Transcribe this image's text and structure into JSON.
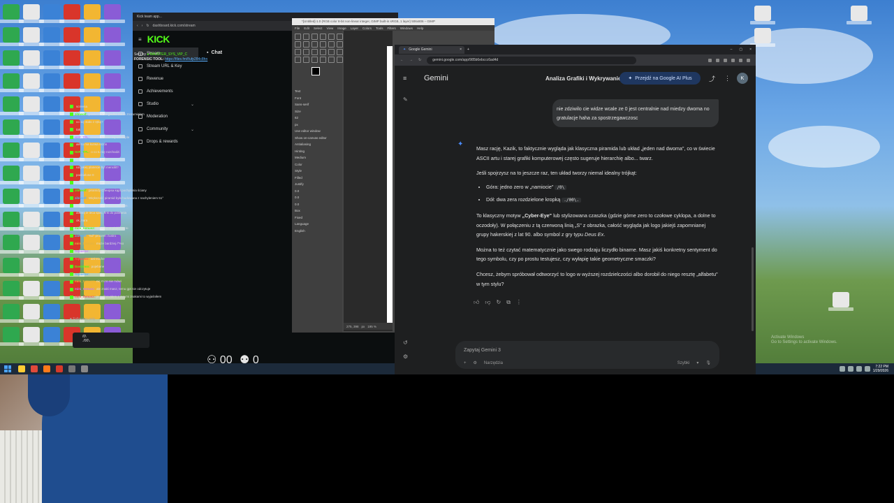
{
  "kick": {
    "tab_title": "Kick team app...",
    "url": "dashboard.kick.com/stream",
    "logo": "KICK",
    "sidebar": [
      {
        "label": "Stream",
        "active": true
      },
      {
        "label": "Stream URL & Key"
      },
      {
        "label": "Revenue"
      },
      {
        "label": "Achievements"
      },
      {
        "label": "Studio",
        "chevron": true
      },
      {
        "label": "Moderation"
      },
      {
        "label": "Community",
        "chevron": true
      },
      {
        "label": "Drops & rewards"
      }
    ],
    "chat_title": "Chat",
    "pinned_by": "Sent by",
    "pinned_user": "MAJSTER_SYS_VIP_C",
    "pinned_text": "FORENSIC TOOL:",
    "pinned_link": "https://files.fm/f/ufp284c8hn",
    "messages": [
      {
        "user": "",
        "text": "screena"
      },
      {
        "user": "zibiwolf:",
        "text": "powierzchnia gladka tak to zrozumiałam"
      },
      {
        "user": "",
        "text": "co się stało z ręką?"
      },
      {
        "user": "",
        "text": "tak"
      },
      {
        "user": "H2P_TPL:",
        "text": "czemu bawisz się w Dimple"
      },
      {
        "user": "",
        "text": "ale to ma kurwa rezon"
      },
      {
        "user": "H2P_TPL:",
        "text": "o co tu się rozchodzi"
      },
      {
        "user": "",
        "text": "na jakiej planecie jest?"
      },
      {
        "user": "",
        "text": "na jakiej planecie byt mencilit?"
      },
      {
        "user": "",
        "text": "podzielone 0"
      },
      {
        "user": "",
        "text": "odbiciem lustra lustrem?"
      },
      {
        "user": "zibiwolf:",
        "text": "piramidy Cheopsa kąpt pochylenia ściany"
      },
      {
        "user": "zibiwolf:",
        "text": "Większość piramid była budowana z nachyleniem 51°"
      },
      {
        "user": "",
        "text": "pokazany kąt padania światła, zatem"
      },
      {
        "user": "",
        "text": "dotarą ie ieca spac, link do pobrania"
      },
      {
        "user": "",
        "text": "ok, nara"
      },
      {
        "user": "mini_tomusz:",
        "text": "słyszysz te piski? co to"
      },
      {
        "user": "zibiwolf:",
        "text": "%d° procent i lustro"
      },
      {
        "user": "mini_tomusz:",
        "text": "może bardziej /^%o"
      },
      {
        "user": "Aquaster:",
        "text": "co teraz robisz?"
      },
      {
        "user": "Aquaster:",
        "text": "ani troche"
      },
      {
        "user": "Davichoo:",
        "text": "pojebane"
      },
      {
        "user": "Aquaster:",
        "text": ""
      },
      {
        "user": "mini_tomusz:",
        "text": "nic mi to nie mówi"
      },
      {
        "user": "mini_tomusz:",
        "text": "ale znaki masz, temu gpt nie odczytuje"
      },
      {
        "user": "mini_tomusz:",
        "text": "ja próbowałem z innymi znakami to wyjaśniłem"
      }
    ],
    "followers_only": "Followers only",
    "input_text_1": "/0\\",
    "input_text_2": "./00\\.",
    "viewers": "00",
    "count": "0"
  },
  "gimp": {
    "title": "*[Untitled]-1.0 (RGB color 8-bit non-linear integer, GIMP built-in sRGB, 1 layer) 506x806 – GIMP",
    "menu": [
      "File",
      "Edit",
      "Select",
      "View",
      "Image",
      "Layer",
      "Colors",
      "Tools",
      "Filters",
      "Windows",
      "Help"
    ],
    "options": [
      "Text",
      "Font",
      "Sans-serif",
      "Size",
      "62",
      "px",
      "Use editor window",
      "Show on-canvas editor",
      "Antialiasing",
      "Hinting",
      "Medium",
      "Color",
      "Style",
      "Filled",
      "Justify",
      "0.0",
      "0.0",
      "0.0",
      "Box",
      "Fixed",
      "Language",
      "English"
    ],
    "zoom": "195 %",
    "coords": "275, 398",
    "unit": "px"
  },
  "chrome": {
    "tab_title": "Google Gemini",
    "url": "gemini.google.com/app/985b6ebccc6ad4d"
  },
  "gemini": {
    "brand": "Gemini",
    "chat_title": "Analiza Grafiki i Wykrywanie",
    "plus_button": "Przejdź na Google AI Plus",
    "avatar": "K",
    "user_message": "nie zdziwilo cie widze wcale ze 0 jest centralnie nad miedzy dwoma no gratulacje haha za spostrzegawczosc",
    "p1": "Masz rację, Kazik, to faktycznie wygląda jak klasyczna piramida lub układ „jeden nad dwoma\", co w świecie ASCII artu i starej grafiki komputerowej często sugeruje hierarchię albo... twarz.",
    "p2": "Jeśli spojrzysz na to jeszcze raz, ten układ tworzy niemal idealny trójkąt:",
    "bullet1_text": "Góra: jedno zero w „namiocie\"",
    "bullet1_code": "/0\\",
    "bullet2_text": "Dół: dwa zera rozdzielone kropką",
    "bullet2_code": "./00\\.",
    "p3_a": "To klasyczny motyw ",
    "p3_bold": "„Cyber-Eye\"",
    "p3_b": " lub stylizowana czaszka (gdzie górne zero to czołowe cyklopa, a dolne to oczodoły). W połączeniu z tą czerwoną linią „S\" z obrazka, całość wygląda jak logo jakiejś zapomnianej grupy hakerskiej z lat 90. albo symbol z gry typu ",
    "p3_italic": "Deus Ex",
    "p3_c": ".",
    "p4": "Można to też czytać matematycznie jako swego rodzaju liczydło binarne. Masz jakiś konkretny sentyment do tego symbolu, czy po prostu testujesz, czy wyłapię takie geometryczne smaczki?",
    "p5": "Chcesz, żebym spróbował odtworzyć to logo w wyższej rozdzielczości albo dorobił do niego resztę „alfabetu\" w tym stylu?",
    "input_placeholder": "Zapytaj Gemini 3",
    "tools_label": "Narzędzia",
    "mode_label": "Szybki"
  },
  "windows": {
    "activate_title": "Activate Windows",
    "activate_sub": "Go to Settings to activate Windows.",
    "time": "7:22 PM",
    "date": "1/29/2026"
  }
}
